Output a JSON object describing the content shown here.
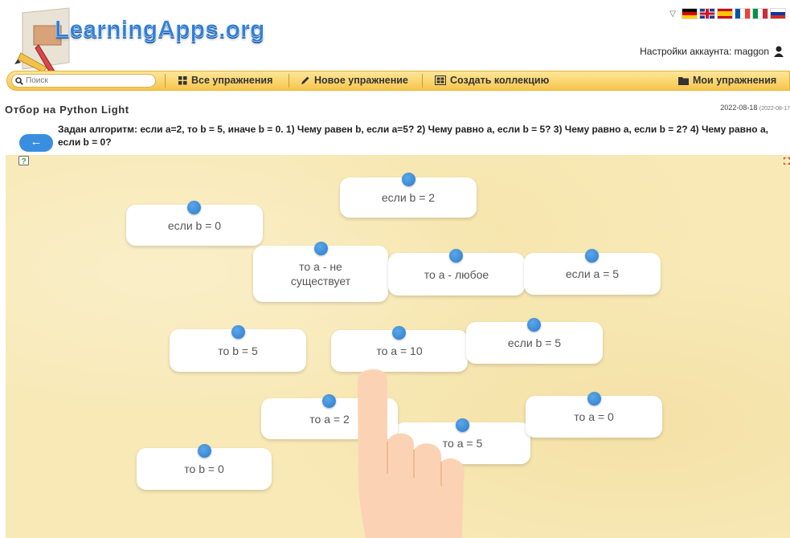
{
  "site": {
    "logo": "LearningApps.org"
  },
  "languages": [
    "de",
    "en",
    "es",
    "fr",
    "it",
    "ru"
  ],
  "account": {
    "label": "Настройки аккаунта: maggon"
  },
  "nav": {
    "search_placeholder": "Поиск",
    "all_exercises": "Все упражнения",
    "new_exercise": "Новое упражнение",
    "create_collection": "Создать коллекцию",
    "my_exercises": "Мои упражнения"
  },
  "exercise": {
    "title": "Отбор на Python Light",
    "date": "2022-08-18",
    "date_secondary": "(2022-08-17",
    "task": "Задан алгоритм: если a=2, то b = 5, иначе b = 0. 1) Чему равен b, если a=5? 2) Чему равно a, если b = 5? 3) Чему равно a, если b = 2? 4) Чему равно a, если b = 0?"
  },
  "cards": [
    "если b = 2",
    "если b = 0",
    "то a - не существует",
    "то a - любое",
    "если a = 5",
    "то b = 5",
    "то a = 10",
    "если b = 5",
    "то a = 2",
    "то a = 5",
    "то a = 0",
    "то b = 0"
  ],
  "colors": {
    "accent": "#2f7fd6",
    "navbar": "#f7c54b",
    "board": "#f8e9b6",
    "dot": "#2c7bcc"
  },
  "icons": {
    "back": "arrow-left-icon",
    "help": "help-icon",
    "fullscreen": "fullscreen-icon"
  }
}
